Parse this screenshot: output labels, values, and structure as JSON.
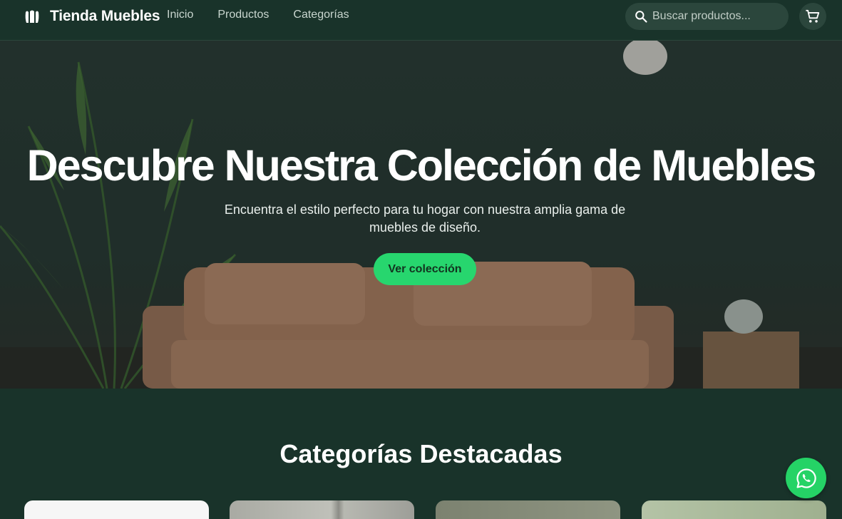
{
  "brand": {
    "name": "Tienda Muebles",
    "icon": "furniture-logo-icon"
  },
  "nav": {
    "items": [
      "Inicio",
      "Productos",
      "Categorías"
    ]
  },
  "search": {
    "placeholder": "Buscar productos...",
    "icon": "search-icon"
  },
  "cart": {
    "icon": "shopping-cart-icon"
  },
  "hero": {
    "title": "Descubre Nuestra Colección de Muebles",
    "subtitle": "Encuentra el estilo perfecto para tu hogar con nuestra amplia gama de muebles de diseño.",
    "cta_label": "Ver colección"
  },
  "categories": {
    "title": "Categorías Destacadas"
  },
  "whatsapp": {
    "icon": "whatsapp-icon"
  },
  "colors": {
    "background": "#19332a",
    "accent": "#27d66e",
    "whatsapp": "#25d366",
    "search_bg": "#2b463c"
  }
}
